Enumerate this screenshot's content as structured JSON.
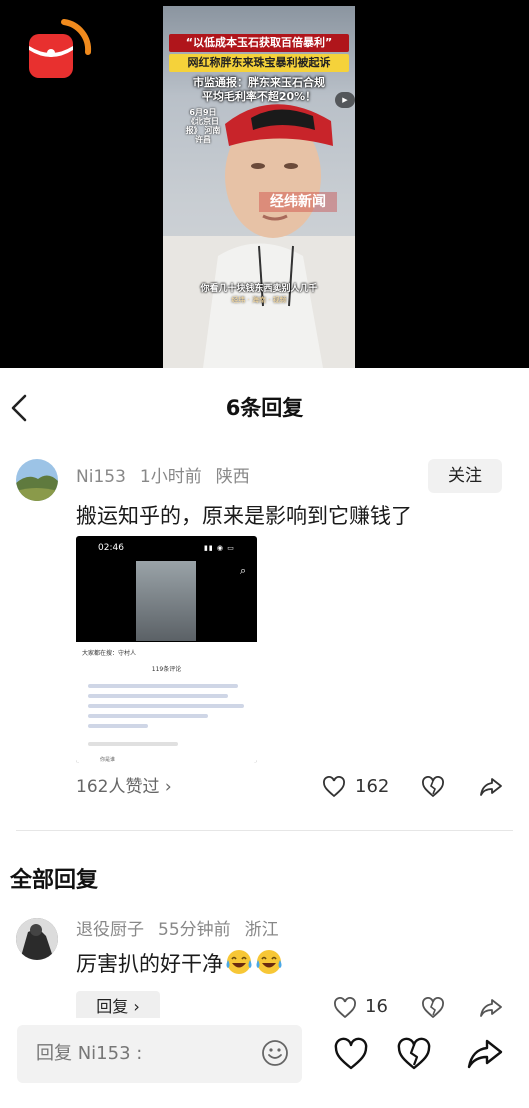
{
  "video": {
    "headline_1": "“以低成本玉石获取百倍暴利”",
    "headline_2": "网红称胖东来珠宝暴利被起诉",
    "headline_3a": "市监通报：胖东来玉石合规",
    "headline_3b": "平均毛利率不超20%！",
    "date": "6月9日 《北京日报》 河南 许昌",
    "watermark": "经纬新闻",
    "subtitle": "你看几十块钱东西卖别人几千",
    "credits": "经纬 · 海南 · 视频"
  },
  "sheet": {
    "title": "6条回复"
  },
  "main_post": {
    "username": "Ni153",
    "time": "1小时前",
    "location": "陕西",
    "follow_label": "关注",
    "text": "搬运知乎的，原来是影响到它赚钱了",
    "likes_text": "162人赞过",
    "like_count": "162",
    "image": {
      "status_time": "02:46",
      "search_hint": "大家都在搜：守村人",
      "comment_count": "119条评论",
      "reply_name": "你是谁"
    }
  },
  "section": {
    "title": "全部回复"
  },
  "reply": {
    "username": "退役厨子",
    "time": "55分钟前",
    "location": "浙江",
    "text": "厉害扒的好干净",
    "reply_label": "回复",
    "like_count": "16"
  },
  "bottom_bar": {
    "input_placeholder": "回复 Ni153 :"
  },
  "colors": {
    "accent_red": "#e8302f",
    "muted": "#888888"
  }
}
